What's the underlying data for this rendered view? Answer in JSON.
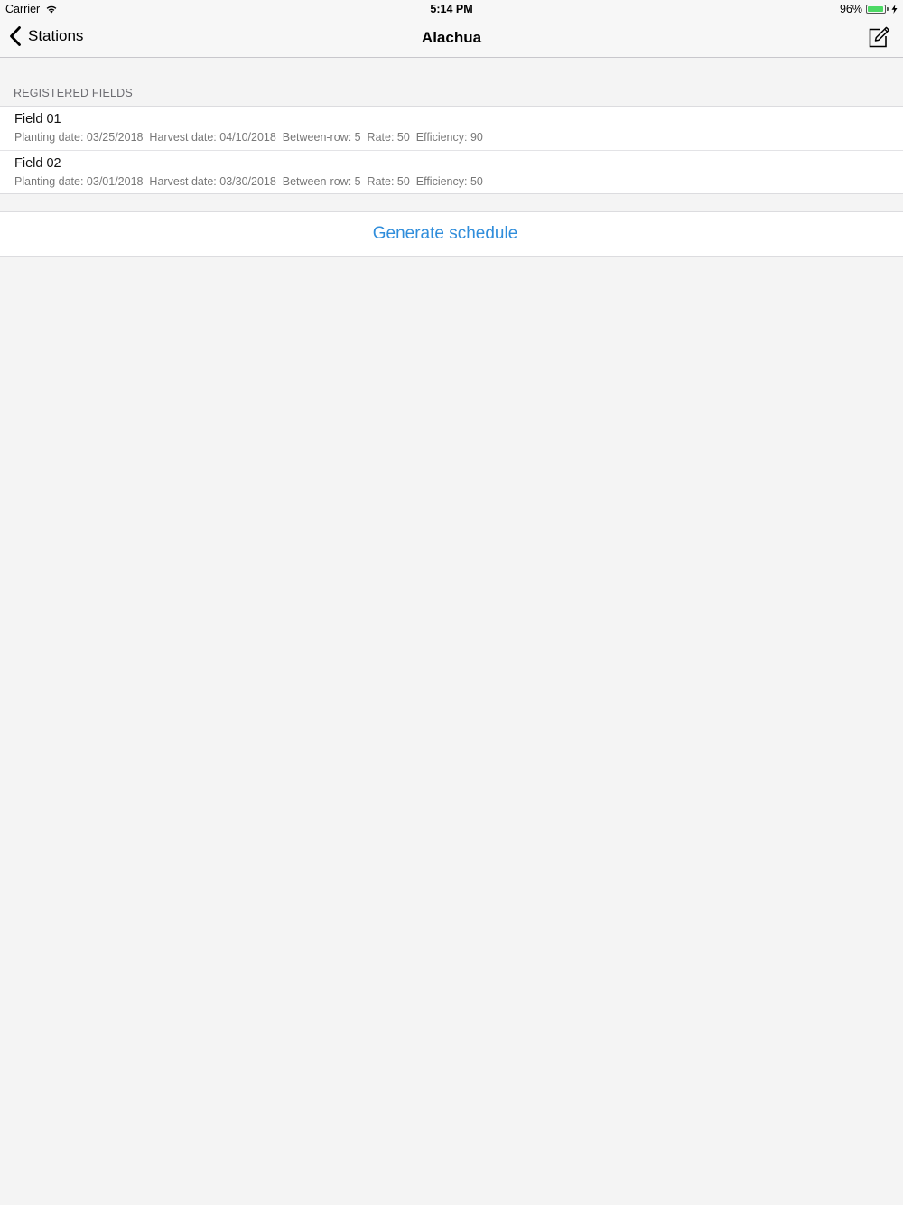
{
  "statusbar": {
    "carrier": "Carrier",
    "time": "5:14 PM",
    "battery_percent": "96%",
    "battery_level": 0.96,
    "icons": [
      "wifi-icon",
      "battery-icon",
      "charging-bolt-icon"
    ],
    "battery_color": "#4cd964"
  },
  "navbar": {
    "back_label": "Stations",
    "title": "Alachua",
    "right_icon": "compose-icon"
  },
  "fields_section": {
    "header": "REGISTERED FIELDS",
    "items": [
      {
        "name": "Field 01",
        "detail": "Planting date: 03/25/2018  Harvest date: 04/10/2018  Between-row: 5  Rate: 50  Efficiency: 90"
      },
      {
        "name": "Field 02",
        "detail": "Planting date: 03/01/2018  Harvest date: 03/30/2018  Between-row: 5  Rate: 50  Efficiency: 50"
      }
    ]
  },
  "actions": {
    "generate_label": "Generate schedule"
  },
  "colors": {
    "accent": "#2f8ddb",
    "background": "#f4f4f4"
  }
}
